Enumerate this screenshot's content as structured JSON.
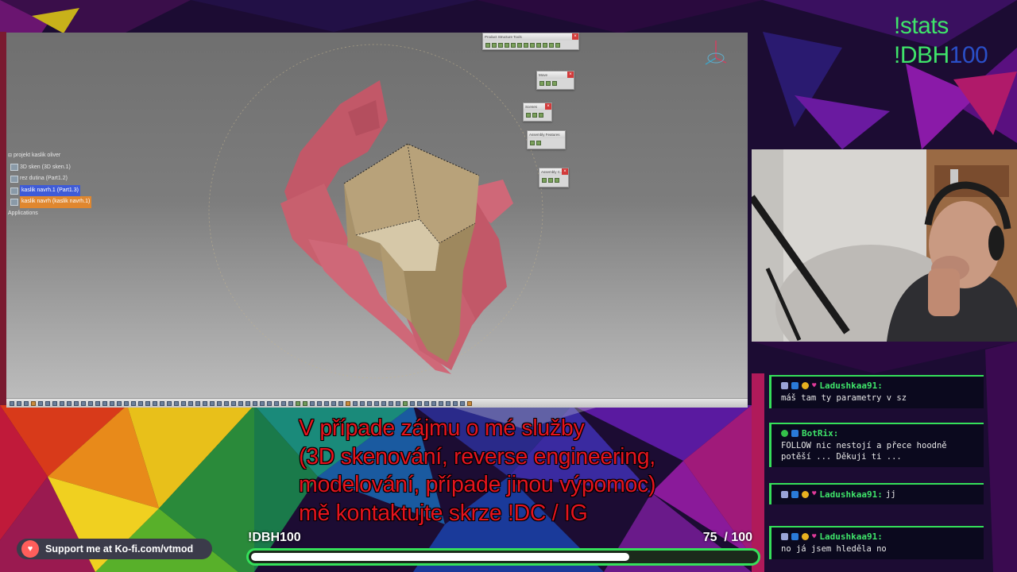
{
  "stats": {
    "line1": "!stats",
    "line2_prefix": "!DBH",
    "line2_num": "100"
  },
  "cad": {
    "tree": [
      {
        "label": "projekt kaslik oliver",
        "style": "root"
      },
      {
        "label": "3D sken (3D sken.1)",
        "style": "normal"
      },
      {
        "label": "rez dutina (Part1.2)",
        "style": "normal"
      },
      {
        "label": "kaslik navrh.1 (Part1.3)",
        "style": "blue"
      },
      {
        "label": "kaslik navrh (kaslik navrh.1)",
        "style": "orange"
      },
      {
        "label": "Applications",
        "style": "root"
      }
    ],
    "panels": {
      "product_structure": "Product Structure Tools",
      "move": "Move",
      "scenes": "Scenes",
      "assembly_features": "Assembly Features",
      "assembly_c": "Assembly C..."
    }
  },
  "subtitle": [
    "V případe zájmu o mé služby",
    "(3D skenování, reverse engineering,",
    "modelování, případe jinou výpomoc)",
    "mě kontaktujte skrze !DC / IG"
  ],
  "goal": {
    "label": "!DBH100",
    "current": "75",
    "separator": "/",
    "target": "100",
    "progress": 0.75
  },
  "kofi": {
    "text": "Support me at Ko-fi.com/vtmod"
  },
  "chat": [
    {
      "name": "Ladushkaa91:",
      "message": "máš tam ty parametry v sz",
      "badges": [
        "b1",
        "b2",
        "b3",
        "b4"
      ]
    },
    {
      "name": "BotRix:",
      "message": "FOLLOW nic nestojí a přece hoodně potěší ... Děkuji ti ...",
      "badges": [
        "b5",
        "b2"
      ]
    },
    {
      "name": "Ladushkaa91:",
      "message": "jj",
      "inline": true,
      "badges": [
        "b1",
        "b2",
        "b3",
        "b4"
      ]
    },
    {
      "name": "Ladushkaa91:",
      "message": "no já jsem hleděla no",
      "badges": [
        "b1",
        "b2",
        "b3",
        "b4"
      ]
    }
  ],
  "colors": {
    "accent_green": "#35e05a",
    "subtitle_red": "#e5141e",
    "stats_green": "#3fe46a",
    "stats_blue": "#2a4fc8"
  }
}
